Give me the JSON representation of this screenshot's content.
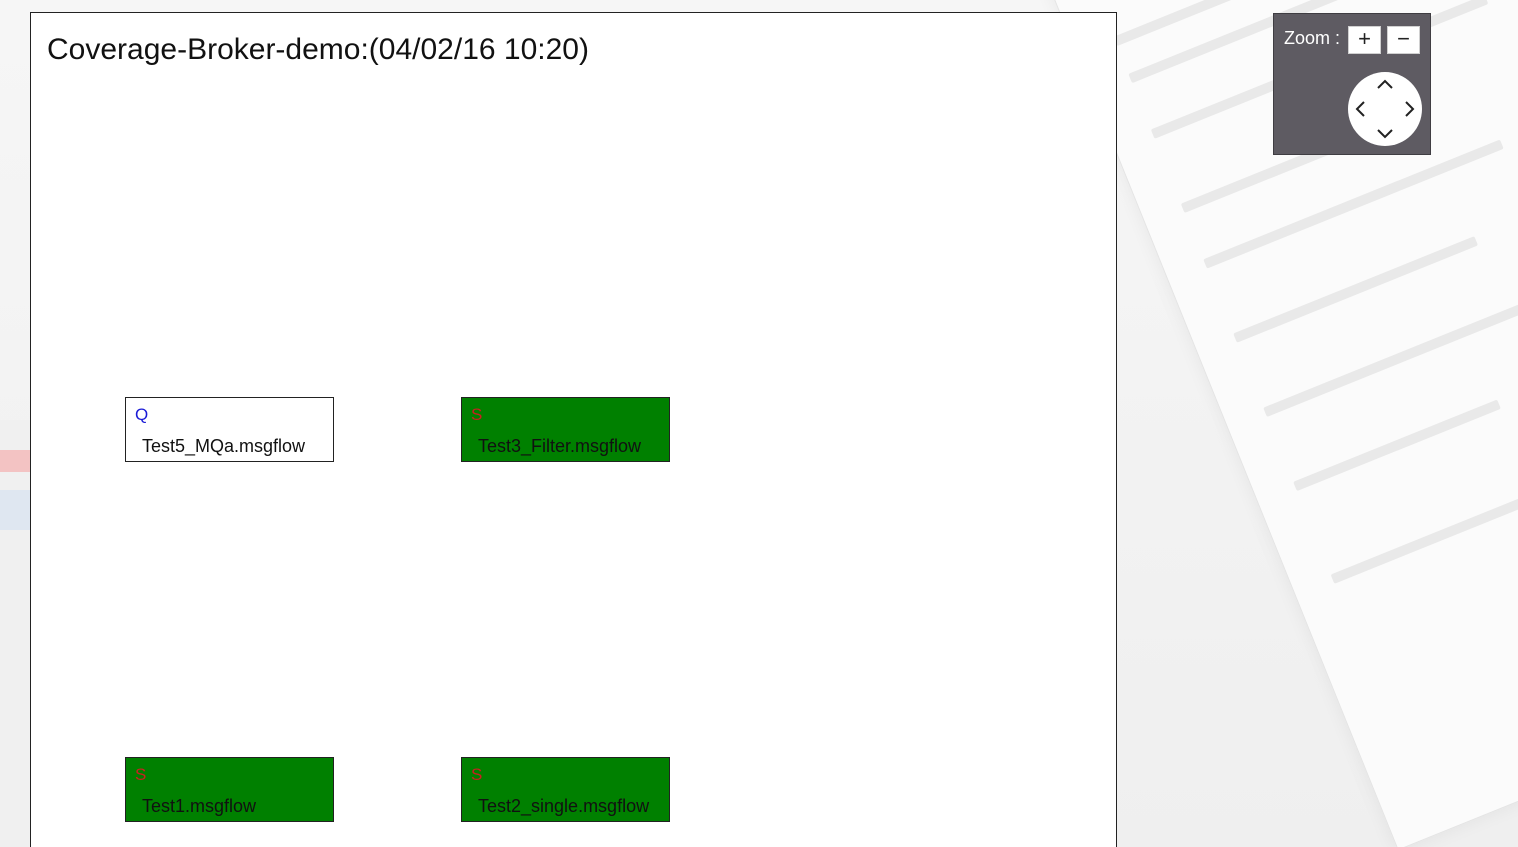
{
  "diagram": {
    "title": "Coverage-Broker-demo:(04/02/16 10:20)",
    "nodes": [
      {
        "label": "Test5_MQa.msgflow",
        "marker": "Q",
        "status": "plain"
      },
      {
        "label": "Test3_Filter.msgflow",
        "marker": "S",
        "status": "green"
      },
      {
        "label": "Test1.msgflow",
        "marker": "S",
        "status": "green"
      },
      {
        "label": "Test2_single.msgflow",
        "marker": "S",
        "status": "green"
      }
    ]
  },
  "zoom": {
    "label": "Zoom :",
    "zoom_in_label": "+",
    "zoom_out_label": "−"
  },
  "colors": {
    "node_green": "#008000",
    "marker_q": "#1a1ad6",
    "marker_s": "#c82020",
    "zoom_panel": "#5e5b62"
  }
}
